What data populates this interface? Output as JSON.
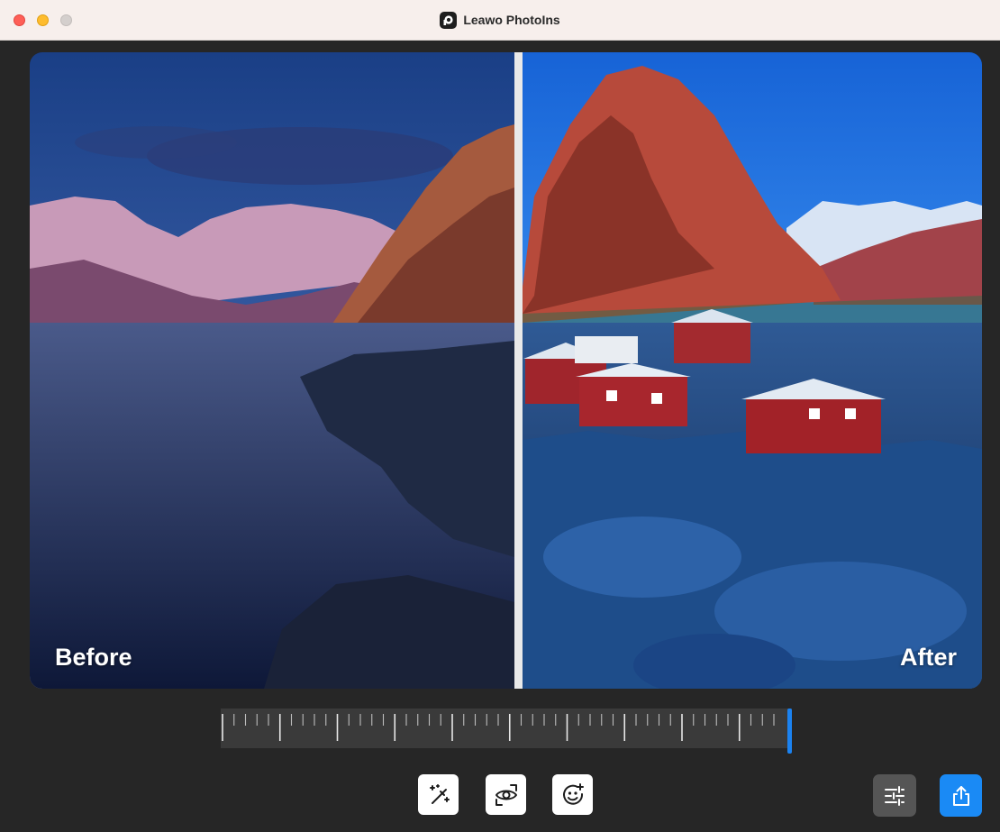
{
  "window": {
    "title": "Leawo PhotoIns",
    "controls": [
      "close-button",
      "minimize-button",
      "zoom-button"
    ]
  },
  "viewer": {
    "before_label": "Before",
    "after_label": "After"
  },
  "slider": {
    "value_fraction": 1.0
  },
  "toolbar": {
    "tools": [
      {
        "name": "magic-wand-icon"
      },
      {
        "name": "eye-icon"
      },
      {
        "name": "face-enhance-icon"
      }
    ],
    "adjust_icon": "sliders-icon",
    "export_icon": "share-export-icon"
  },
  "colors": {
    "accent": "#1a8af5",
    "background": "#262626",
    "titlebar": "#f7efec",
    "slider_track": "#3a3a3a"
  }
}
